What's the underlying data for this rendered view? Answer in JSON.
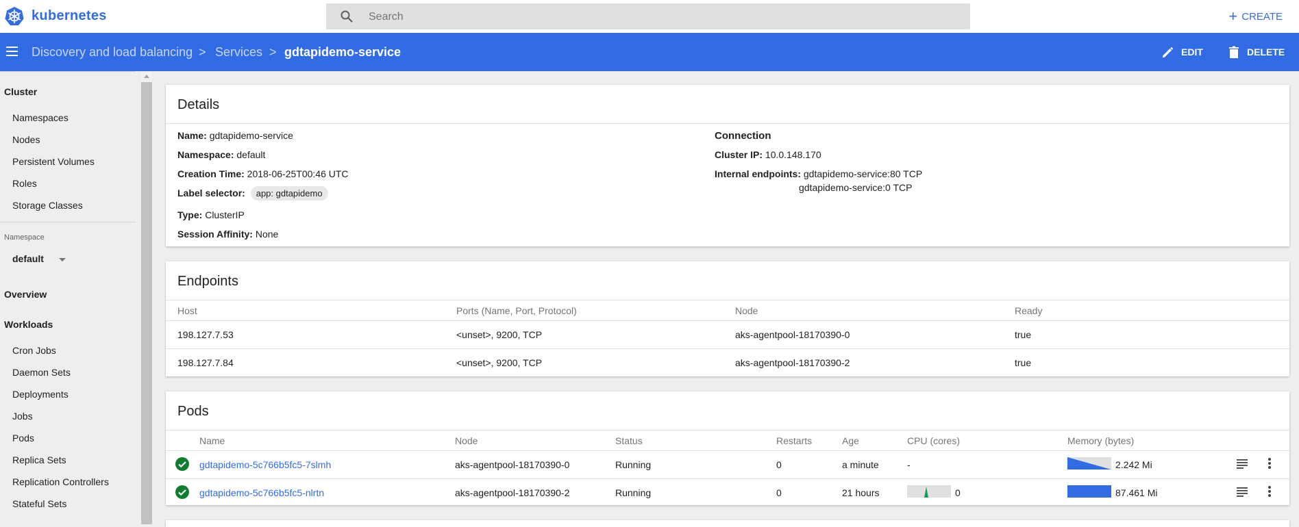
{
  "header": {
    "brand": "kubernetes",
    "search_placeholder": "Search",
    "create_label": "CREATE"
  },
  "breadcrumb": {
    "items": [
      "Discovery and load balancing",
      "Services"
    ],
    "current": "gdtapidemo-service",
    "separator": ">"
  },
  "actions": {
    "edit": "EDIT",
    "delete": "DELETE"
  },
  "sidebar": {
    "cluster_heading": "Cluster",
    "cluster_items": [
      "Namespaces",
      "Nodes",
      "Persistent Volumes",
      "Roles",
      "Storage Classes"
    ],
    "namespace_label": "Namespace",
    "namespace_value": "default",
    "overview": "Overview",
    "workloads_heading": "Workloads",
    "workload_items": [
      "Cron Jobs",
      "Daemon Sets",
      "Deployments",
      "Jobs",
      "Pods",
      "Replica Sets",
      "Replication Controllers",
      "Stateful Sets"
    ]
  },
  "details": {
    "title": "Details",
    "name_label": "Name:",
    "name_value": "gdtapidemo-service",
    "namespace_label": "Namespace:",
    "namespace_value": "default",
    "creation_label": "Creation Time:",
    "creation_value": "2018-06-25T00:46 UTC",
    "selector_label": "Label selector:",
    "selector_value": "app: gdtapidemo",
    "type_label": "Type:",
    "type_value": "ClusterIP",
    "affinity_label": "Session Affinity:",
    "affinity_value": "None",
    "connection_heading": "Connection",
    "cluster_ip_label": "Cluster IP:",
    "cluster_ip_value": "10.0.148.170",
    "internal_label": "Internal endpoints:",
    "internal_values": [
      "gdtapidemo-service:80 TCP",
      "gdtapidemo-service:0 TCP"
    ]
  },
  "endpoints": {
    "title": "Endpoints",
    "headers": [
      "Host",
      "Ports (Name, Port, Protocol)",
      "Node",
      "Ready"
    ],
    "rows": [
      [
        "198.127.7.53",
        "<unset>, 9200, TCP",
        "aks-agentpool-18170390-0",
        "true"
      ],
      [
        "198.127.7.84",
        "<unset>, 9200, TCP",
        "aks-agentpool-18170390-2",
        "true"
      ]
    ]
  },
  "pods": {
    "title": "Pods",
    "headers": [
      "Name",
      "Node",
      "Status",
      "Restarts",
      "Age",
      "CPU (cores)",
      "Memory (bytes)"
    ],
    "rows": [
      {
        "name": "gdtapidemo-5c766b5fc5-7slmh",
        "node": "aks-agentpool-18170390-0",
        "status": "Running",
        "restarts": "0",
        "age": "a minute",
        "cpu": "-",
        "memory": "2.242 Mi"
      },
      {
        "name": "gdtapidemo-5c766b5fc5-nlrtn",
        "node": "aks-agentpool-18170390-2",
        "status": "Running",
        "restarts": "0",
        "age": "21 hours",
        "cpu": "0",
        "memory": "87.461 Mi"
      }
    ]
  },
  "colors": {
    "primary": "#326ce5",
    "ok": "#0f9d58",
    "cpu_spark": "#0f9d58"
  }
}
